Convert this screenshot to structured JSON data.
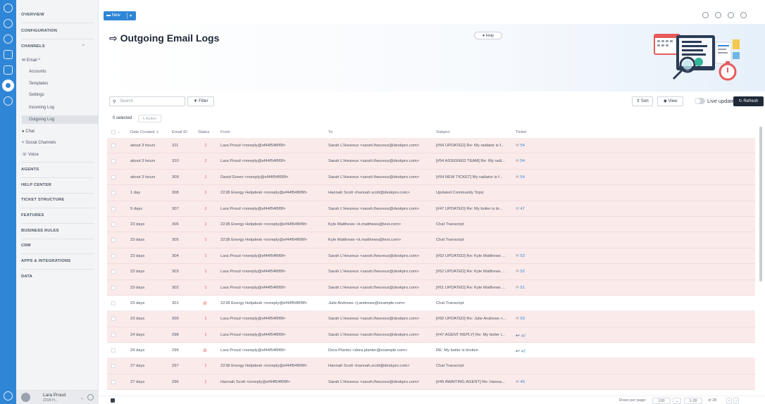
{
  "sidebar": {
    "sections": {
      "overview": "OVERVIEW",
      "configuration": "CONFIGURATION",
      "channels": "CHANNELS",
      "agents": "AGENTS",
      "help_center": "HELP CENTER",
      "ticket_structure": "TICKET STRUCTURE",
      "features": "FEATURES",
      "business_rules": "BUSINESS RULES",
      "crm": "CRM",
      "apps": "APPS & INTEGRATIONS",
      "data": "DATA"
    },
    "email": "Email ^",
    "email_items": [
      "Accounts",
      "Templates",
      "Settings",
      "Incoming Log",
      "Outgoing Log"
    ],
    "chat": "Chat",
    "social": "Social Channels",
    "voice": "Voice",
    "user_name": "Lara Proud",
    "user_org": "221B H...",
    "caret": "^"
  },
  "topbar": {
    "new_label": "New"
  },
  "page": {
    "title": "Outgoing Email Logs",
    "help": "Help"
  },
  "toolbar": {
    "search_placeholder": "Search",
    "filter": "Filter",
    "sort": "Sort",
    "view": "View",
    "live_updates": "Live updates",
    "refresh": "Refresh",
    "selected": "0 selected",
    "action": "Action"
  },
  "table": {
    "headers": [
      "Date Created",
      "Email ID",
      "Status",
      "From",
      "To",
      "Subject",
      "Ticket"
    ],
    "rows": [
      {
        "date": "about 3 hours",
        "id": "311",
        "status": "err",
        "from": "Lara Proud <noreply@ef44f54f6f9f>",
        "to": "Sarah L'Heureux <sarah.lheureux@deskpro.com>",
        "subject": "[#54 UPDATED] Re: My radiator is f...",
        "ticket": "54",
        "tk": "mail"
      },
      {
        "date": "about 3 hours",
        "id": "310",
        "status": "err",
        "from": "Lara Proud <noreply@ef44f54f6f9f>",
        "to": "Sarah L'Heureux <sarah.lheureux@deskpro.com>",
        "subject": "[#54 ASSIGNED TEAM] Re: My radi...",
        "ticket": "54",
        "tk": "mail"
      },
      {
        "date": "about 3 hours",
        "id": "309",
        "status": "err",
        "from": "David Green <noreply@ef44f54f6f9f>",
        "to": "Sarah L'Heureux <sarah.lheureux@deskpro.com>",
        "subject": "[#54 NEW TICKET] My radiator is f...",
        "ticket": "54",
        "tk": "mail"
      },
      {
        "date": "1 day",
        "id": "308",
        "status": "err",
        "from": "221B Energy Helpdesk <noreply@ef44f54f6f9f>",
        "to": "Hannah Scott <hannah.scott@deskpro.com>",
        "subject": "Updated Community Topic",
        "ticket": "",
        "tk": ""
      },
      {
        "date": "9 days",
        "id": "307",
        "status": "err",
        "from": "Lara Proud <noreply@ef44f54f6f9f>",
        "to": "Sarah L'Heureux <sarah.lheureux@deskpro.com>",
        "subject": "[#47 UPDATED] Re: My boiler is br...",
        "ticket": "47",
        "tk": "mail"
      },
      {
        "date": "23 days",
        "id": "306",
        "status": "err",
        "from": "221B Energy Helpdesk <noreply@ef44f54f6f9f>",
        "to": "Kyle Matthews <k.matthews@test.com>",
        "subject": "Chat Transcript",
        "ticket": "",
        "tk": ""
      },
      {
        "date": "23 days",
        "id": "305",
        "status": "err",
        "from": "221B Energy Helpdesk <noreply@ef44f54f6f9f>",
        "to": "Kyle Matthews <k.matthews@test.com>",
        "subject": "Chat Transcript",
        "ticket": "",
        "tk": ""
      },
      {
        "date": "23 days",
        "id": "304",
        "status": "err",
        "from": "Lara Proud <noreply@ef44f54f6f9f>",
        "to": "Sarah L'Heureux <sarah.lheureux@deskpro.com>",
        "subject": "[#53 UPDATED] Re: Kyle Matthews ...",
        "ticket": "53",
        "tk": "mail"
      },
      {
        "date": "23 days",
        "id": "303",
        "status": "err",
        "from": "Lara Proud <noreply@ef44f54f6f9f>",
        "to": "Sarah L'Heureux <sarah.lheureux@deskpro.com>",
        "subject": "[#52 UPDATED] Re: Kyle Matthews ...",
        "ticket": "52",
        "tk": "mail"
      },
      {
        "date": "23 days",
        "id": "302",
        "status": "err",
        "from": "Lara Proud <noreply@ef44f54f6f9f>",
        "to": "Sarah L'Heureux <sarah.lheureux@deskpro.com>",
        "subject": "[#51 UPDATED] Re: Kyle Matthews ...",
        "ticket": "51",
        "tk": "mail"
      },
      {
        "date": "23 days",
        "id": "301",
        "status": "block",
        "from": "221B Energy Helpdesk <noreply@ef44f54f6f9f>",
        "to": "Julie Andrews <j.andrews@example.com>",
        "subject": "Chat Transcript",
        "ticket": "",
        "tk": ""
      },
      {
        "date": "23 days",
        "id": "300",
        "status": "err",
        "from": "Lara Proud <noreply@ef44f54f6f9f>",
        "to": "Sarah L'Heureux <sarah.lheureux@deskpro.com>",
        "subject": "[#50 UPDATED] Re: Julie Andrews <...",
        "ticket": "50",
        "tk": "mail"
      },
      {
        "date": "24 days",
        "id": "298",
        "status": "err",
        "from": "Lara Proud <noreply@ef44f54f6f9f>",
        "to": "Sarah L'Heureux <sarah.lheureux@deskpro.com>",
        "subject": "[#47 AGENT REPLY] Re: My boiler i...",
        "ticket": "47",
        "tk": "reply"
      },
      {
        "date": "24 days",
        "id": "299",
        "status": "block",
        "from": "Lara Proud <noreply@ef44f54f6f9f>",
        "to": "Dora Planter <dora.planter@example.com>",
        "subject": "RE: My boiler is broken",
        "ticket": "47",
        "tk": "reply"
      },
      {
        "date": "27 days",
        "id": "297",
        "status": "err",
        "from": "221B Energy Helpdesk <noreply@ef44f54f6f9f>",
        "to": "Hannah Scott <hannah.scott@deskpro.com>",
        "subject": "Chat Transcript",
        "ticket": "",
        "tk": ""
      },
      {
        "date": "27 days",
        "id": "296",
        "status": "err",
        "from": "Hannah Scott <noreply@ef44f54f6f9f>",
        "to": "Sarah L'Heureux <sarah.lheureux@deskpro.com>",
        "subject": "[#49 AWAITING AGENT] Re: Hanna...",
        "ticket": "49",
        "tk": "mail"
      }
    ]
  },
  "footer": {
    "rows_per_page_label": "Rows per page:",
    "rows_per_page": "100",
    "range": "1-28",
    "of": "of 28"
  }
}
